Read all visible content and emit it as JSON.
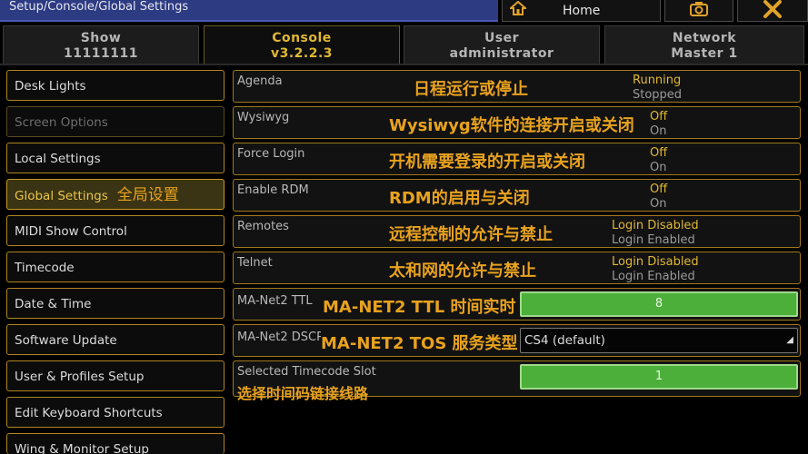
{
  "header": {
    "title": "Setup/Console/Global Settings",
    "home_label": "Home",
    "home_icon": "house-icon",
    "camera_icon": "camera-icon",
    "close_icon": "close-icon"
  },
  "tabs": [
    {
      "line1": "Show",
      "line2": "11111111"
    },
    {
      "line1": "Console",
      "line2": "v3.2.2.3"
    },
    {
      "line1": "User",
      "line2": "administrator"
    },
    {
      "line1": "Network",
      "line2": "Master 1"
    }
  ],
  "sidebar": {
    "items": [
      {
        "label": "Desk Lights"
      },
      {
        "label": "Screen Options"
      },
      {
        "label": "Local Settings"
      },
      {
        "label": "Global Settings",
        "annotation": "全局设置"
      },
      {
        "label": "MIDI Show Control"
      },
      {
        "label": "Timecode"
      },
      {
        "label": "Date & Time"
      },
      {
        "label": "Software Update"
      },
      {
        "label": "User & Profiles Setup"
      },
      {
        "label": "Edit Keyboard Shortcuts"
      },
      {
        "label": "Wing & Monitor Setup"
      }
    ]
  },
  "settings": {
    "agenda": {
      "label": "Agenda",
      "annotation": "日程运行或停止",
      "option1": "Running",
      "option2": "Stopped"
    },
    "wysiwyg": {
      "label": "Wysiwyg",
      "annotation": "Wysiwyg软件的连接开启或关闭",
      "option1": "Off",
      "option2": "On"
    },
    "force_login": {
      "label": "Force Login",
      "annotation": "开机需要登录的开启或关闭",
      "option1": "Off",
      "option2": "On"
    },
    "enable_rdm": {
      "label": "Enable RDM",
      "annotation": "RDM的启用与关闭",
      "option1": "Off",
      "option2": "On"
    },
    "remotes": {
      "label": "Remotes",
      "annotation": "远程控制的允许与禁止",
      "option1": "Login Disabled",
      "option2": "Login Enabled"
    },
    "telnet": {
      "label": "Telnet",
      "annotation": "太和网的允许与禁止",
      "option1": "Login Disabled",
      "option2": "Login Enabled"
    },
    "ttl": {
      "label": "MA-Net2 TTL",
      "annotation": "MA-NET2 TTL 时间实时",
      "value": "8"
    },
    "dscp": {
      "label": "MA-Net2 DSCP",
      "annotation": "MA-NET2 TOS 服务类型",
      "value": "CS4 (default)"
    },
    "timecode_slot": {
      "label": "Selected Timecode Slot",
      "annotation": "选择时间码链接线路",
      "value": "1"
    }
  }
}
